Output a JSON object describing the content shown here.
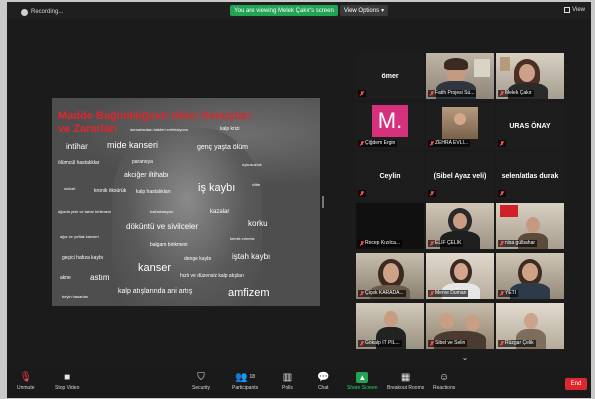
{
  "topbar": {
    "recording_label": "Recording...",
    "viewing_banner": "You are viewing Melek Çakır's screen",
    "view_options": "View Options",
    "view_label": "View"
  },
  "slide": {
    "title": "Madde Bağımlılığının Olası Sonuçları ve Zararları",
    "words": [
      "damarlardan bakteri enfeksiyonu",
      "kalp krizi",
      "intihar",
      "mide kanseri",
      "genç yaşta ölüm",
      "ölümcül hastalıklar",
      "paranoya",
      "akciğer iltihabı",
      "uykusuzluk",
      "kalp hastalıkları",
      "iş kaybı",
      "ciltte",
      "sinüzit",
      "kronik öksürük",
      "ağızda pisk ve tartar birikmesi",
      "halüsinasyon",
      "kazalar",
      "döküntü ve sivilceler",
      "korku",
      "ağız ve yırtlak kanseri",
      "balgam birikmesi",
      "kemik erimesi",
      "geçici hafıza kaybı",
      "denge kaybı",
      "iştah kaybı",
      "kanser",
      "akne",
      "astım",
      "hızlı ve düzensiz kalp atışları",
      "kalp atışlarında ani artış",
      "beyin hasarları",
      "amfizem"
    ]
  },
  "participants": [
    {
      "name": "ömer",
      "label": "ömer",
      "type": "name"
    },
    {
      "name": "Fatih Projesi Sü...",
      "label": "Fatih Projesi Sü...",
      "type": "video"
    },
    {
      "name": "Melek Çakır",
      "label": "Melek Çakır",
      "type": "video",
      "active": true
    },
    {
      "name": "Çiğdem Ergin",
      "label": "Çiğdem Ergin",
      "type": "avatar",
      "initial": "M."
    },
    {
      "name": "ZEHRA EVLİ...",
      "label": "ZEHRA EVLİ...",
      "type": "video"
    },
    {
      "name": "URAS ÖNAY",
      "label": "URAS ÖNAY",
      "type": "name"
    },
    {
      "name": "Ceylin",
      "label": "Ceylin",
      "type": "name"
    },
    {
      "name": "(Sibel Ayaz veli)",
      "label": "(Sibel Ayaz veli)",
      "type": "name"
    },
    {
      "name": "selen/atlas durak",
      "label": "selen/atlas durak",
      "type": "name"
    },
    {
      "name": "Recep Kızılca...",
      "label": "Recep Kızılca...",
      "type": "dark"
    },
    {
      "name": "ELİF ÇELİK",
      "label": "ELİF ÇELİK",
      "type": "video"
    },
    {
      "name": "nisa gülbahar",
      "label": "nisa gülbahar",
      "type": "video"
    },
    {
      "name": "Çiçek KARADA...",
      "label": "Çiçek KARADA...",
      "type": "video"
    },
    {
      "name": "Merve Duman",
      "label": "Merve Duman",
      "type": "video"
    },
    {
      "name": "YETİ",
      "label": "YETİ",
      "type": "video"
    },
    {
      "name": "Gökalp İT PİL...",
      "label": "Gökalp İT PİL...",
      "type": "video"
    },
    {
      "name": "Sibel ve Selin",
      "label": "Sibel ve Selin",
      "type": "video"
    },
    {
      "name": "Rüzgar Çelik",
      "label": "Rüzgar Çelik",
      "type": "video"
    }
  ],
  "toolbar": {
    "unmute": "Unmute",
    "stop_video": "Stop Video",
    "security": "Security",
    "participants": "Participants",
    "participants_count": "18",
    "polls": "Polls",
    "chat": "Chat",
    "share_screen": "Share Screen",
    "breakout_rooms": "Breakout Rooms",
    "reactions": "Reactions",
    "end": "End"
  },
  "colors": {
    "share_green": "#23a455",
    "end_red": "#e0252d",
    "slide_title_red": "#e0262d",
    "active_speaker": "#c7d93d",
    "avatar_magenta": "#d6317d"
  }
}
